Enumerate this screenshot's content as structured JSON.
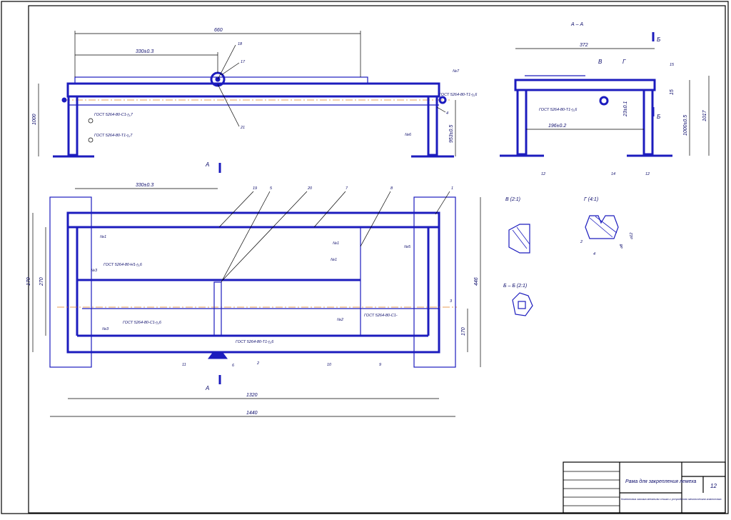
{
  "title_block": {
    "title": "Рама для закрепления лемеха",
    "sheet_number": "12",
    "note": "Компоновка зажима механизм стыка и устройство механическая компоновка"
  },
  "dimensions": {
    "top_overall": "660",
    "top_offset": "330±0.3",
    "top_height": "1000",
    "top_right_h": "953±0.5",
    "plan_offset": "330±0.3",
    "plan_left_1": "170",
    "plan_left_2": "270",
    "plan_right_1": "446",
    "plan_right_2": "170",
    "plan_width_inner": "1320",
    "plan_width_outer": "1440",
    "side_width": "372",
    "side_inner": "196±0.2",
    "side_h1": "1000±0.5",
    "side_h2": "1017",
    "side_h3": "23±0.1",
    "side_h4": "15"
  },
  "labels": {
    "section_aa": "А – А",
    "view_v": "В (2:1)",
    "view_g": "Г (4:1)",
    "view_bb": "Б – Б (2:1)",
    "cut_a": "А",
    "cut_b": "Б",
    "view_letter_v": "В",
    "view_letter_g": "Г",
    "g_dim_2": "2",
    "g_dim_4": "4",
    "g_dim_d8": "⌀8",
    "g_dim_d12": "⌀12"
  },
  "welds": {
    "w1": "ГОСТ 5264-80-С1-◺7",
    "w2": "ГОСТ 5264-80-Т1-◺7",
    "w3": "ГОСТ 5264-80-Т1-◺6",
    "w4": "ГОСТ 5264-80-Т1-◺6",
    "w5": "ГОСТ 5264-80-Н1-◺6",
    "w6": "ГОСТ 5264-80-С1-◺6",
    "w7": "ГОСТ 5264-80-С1-",
    "w8": "ГОСТ 5264-80-Т1-◺6"
  },
  "weld_marks": {
    "m1": "№7",
    "m2": "№6",
    "m3": "№1",
    "m4": "№1",
    "m5": "№1",
    "m6": "№5",
    "m7": "№2",
    "m8": "№3",
    "m9": "№3"
  },
  "parts": [
    "1",
    "2",
    "3",
    "4",
    "5",
    "6",
    "7",
    "8",
    "9",
    "10",
    "11",
    "12",
    "13",
    "14",
    "15",
    "16",
    "17",
    "18",
    "19",
    "20",
    "21"
  ],
  "colors": {
    "part": "#1c1cbe",
    "axis": "#e08020",
    "frame": "#000000"
  }
}
